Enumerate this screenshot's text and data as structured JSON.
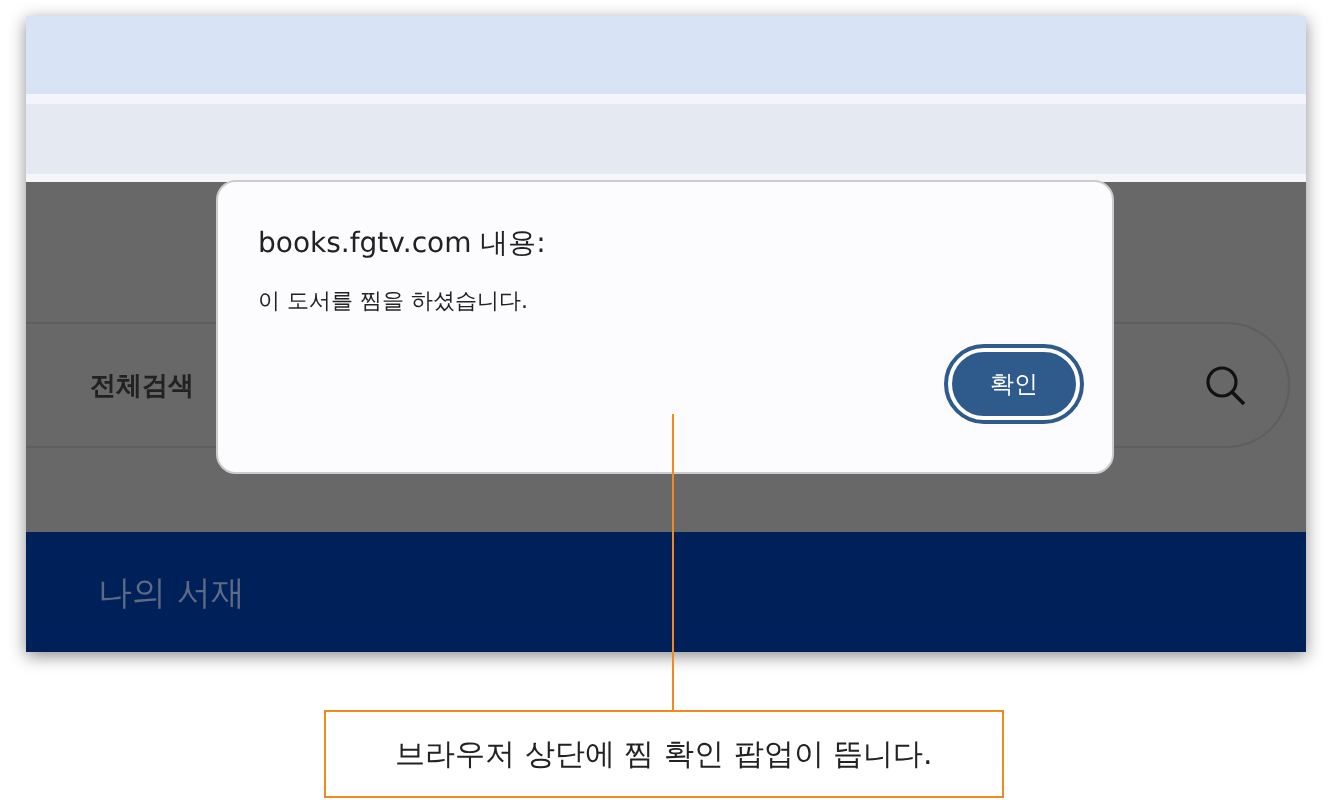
{
  "search": {
    "scope_label": "전체검색"
  },
  "nav": {
    "title": "나의 서재"
  },
  "dialog": {
    "origin": "books.fgtv.com 내용:",
    "message": "이 도서를 찜을 하셨습니다.",
    "buttons": [
      "확인"
    ]
  },
  "callout": {
    "text": "브라우저 상단에 찜 확인 팝업이 뜹니다."
  }
}
